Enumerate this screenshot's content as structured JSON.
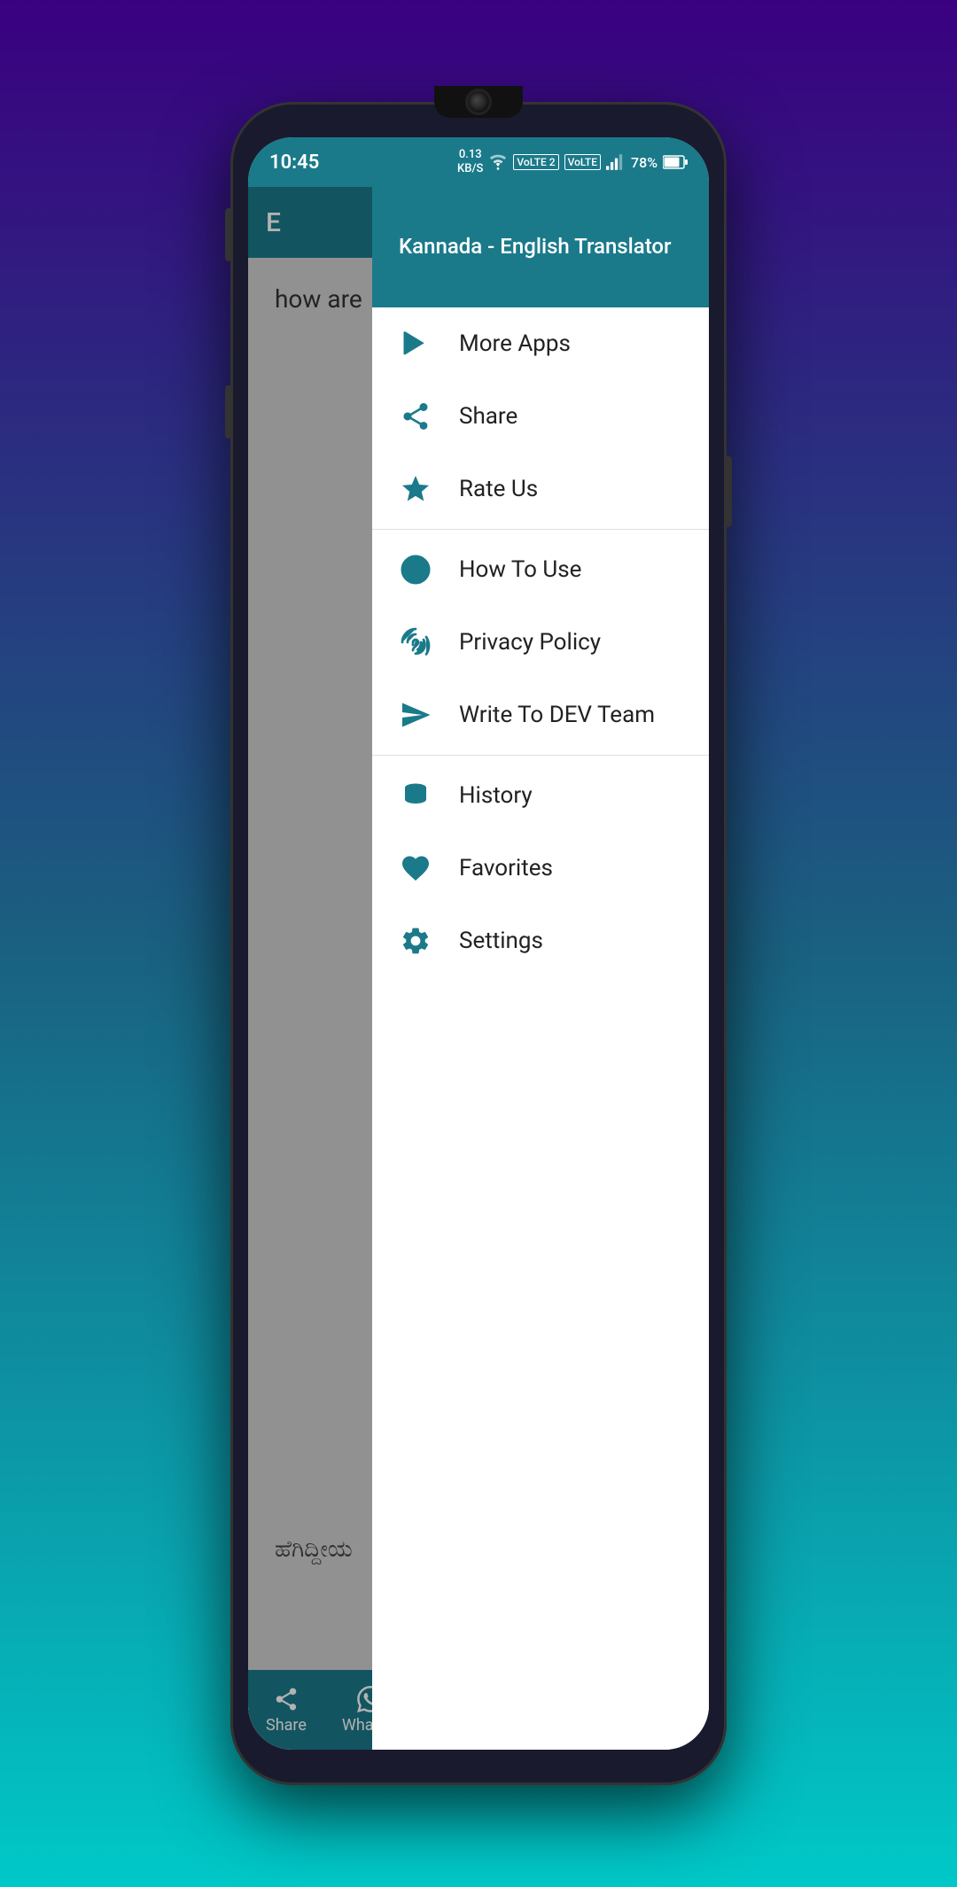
{
  "statusBar": {
    "time": "10:45",
    "data": "0.13\nKB/S",
    "battery": "78%"
  },
  "appHeader": {
    "title": "E"
  },
  "drawer": {
    "title": "Kannada - English Translator",
    "menuItems": [
      {
        "id": "more-apps",
        "label": "More Apps",
        "icon": "play-store"
      },
      {
        "id": "share",
        "label": "Share",
        "icon": "share"
      },
      {
        "id": "rate-us",
        "label": "Rate Us",
        "icon": "star"
      },
      {
        "id": "how-to-use",
        "label": "How To Use",
        "icon": "question"
      },
      {
        "id": "privacy-policy",
        "label": "Privacy Policy",
        "icon": "fingerprint"
      },
      {
        "id": "write-dev",
        "label": "Write To DEV Team",
        "icon": "send"
      },
      {
        "id": "history",
        "label": "History",
        "icon": "history"
      },
      {
        "id": "favorites",
        "label": "Favorites",
        "icon": "heart"
      },
      {
        "id": "settings",
        "label": "Settings",
        "icon": "gear"
      }
    ]
  },
  "sourceText": "how are",
  "translatedText": "ಹೆಗಿದ್ದೀಯ",
  "bottomBar": {
    "share": "Share",
    "whatsapp": "Whats..."
  }
}
